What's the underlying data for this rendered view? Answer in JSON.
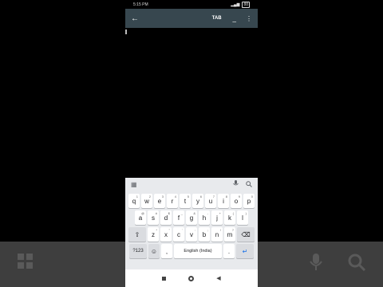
{
  "status": {
    "time": "5:15 PM",
    "battery": "88"
  },
  "appbar": {
    "tab_label": "TAB",
    "dash_label": "_"
  },
  "keyboard": {
    "row1": [
      {
        "k": "q",
        "h": "1"
      },
      {
        "k": "w",
        "h": "2"
      },
      {
        "k": "e",
        "h": "3"
      },
      {
        "k": "r",
        "h": "4"
      },
      {
        "k": "t",
        "h": "5"
      },
      {
        "k": "y",
        "h": "6"
      },
      {
        "k": "u",
        "h": "7"
      },
      {
        "k": "i",
        "h": "8"
      },
      {
        "k": "o",
        "h": "9"
      },
      {
        "k": "p",
        "h": "0"
      }
    ],
    "row2": [
      {
        "k": "a",
        "h": "@"
      },
      {
        "k": "s",
        "h": "#"
      },
      {
        "k": "d",
        "h": "$"
      },
      {
        "k": "f",
        "h": "_"
      },
      {
        "k": "g",
        "h": "&"
      },
      {
        "k": "h",
        "h": "-"
      },
      {
        "k": "j",
        "h": "+"
      },
      {
        "k": "k",
        "h": "("
      },
      {
        "k": "l",
        "h": ")"
      }
    ],
    "row3": [
      {
        "k": "z",
        "h": "*"
      },
      {
        "k": "x",
        "h": "\""
      },
      {
        "k": "c",
        "h": "'"
      },
      {
        "k": "v",
        "h": ":"
      },
      {
        "k": "b",
        "h": ";"
      },
      {
        "k": "n",
        "h": "!"
      },
      {
        "k": "m",
        "h": "?"
      }
    ],
    "shift_label": "⇧",
    "backspace_label": "⌫",
    "numbers_label": "?123",
    "emoji_label": "☺",
    "comma_label": ",",
    "space_label": "English (India)",
    "period_label": ".",
    "enter_label": "↵"
  },
  "icons": {
    "back": "arrow-left-icon",
    "more": "more-vert-icon",
    "grid": "grid-icon",
    "mic": "mic-icon",
    "search": "search-icon"
  },
  "colors": {
    "appbar": "#37474f",
    "keyboard_bg": "#e8eaed",
    "enter": "#1a73e8"
  }
}
